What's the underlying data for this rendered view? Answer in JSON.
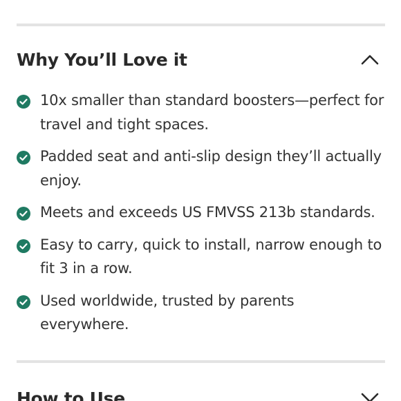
{
  "why_section": {
    "title": "Why You’ll Love it",
    "expanded": true,
    "toggle_icon": "chevron-up-icon",
    "bullet_icon": "check-circle-icon",
    "accent_color": "#1f7a62",
    "items": [
      {
        "text": "10x smaller than standard boosters—perfect for travel and tight spaces."
      },
      {
        "text": "Padded seat and anti-slip design they’ll actually enjoy."
      },
      {
        "text": "Meets and exceeds US FMVSS 213b standards."
      },
      {
        "text": "Easy to carry, quick to install, narrow enough to fit 3 in a row."
      },
      {
        "text": "Used worldwide, trusted by parents everywhere."
      }
    ]
  },
  "how_section": {
    "title": "How to Use",
    "expanded": false,
    "toggle_icon": "chevron-down-icon"
  }
}
